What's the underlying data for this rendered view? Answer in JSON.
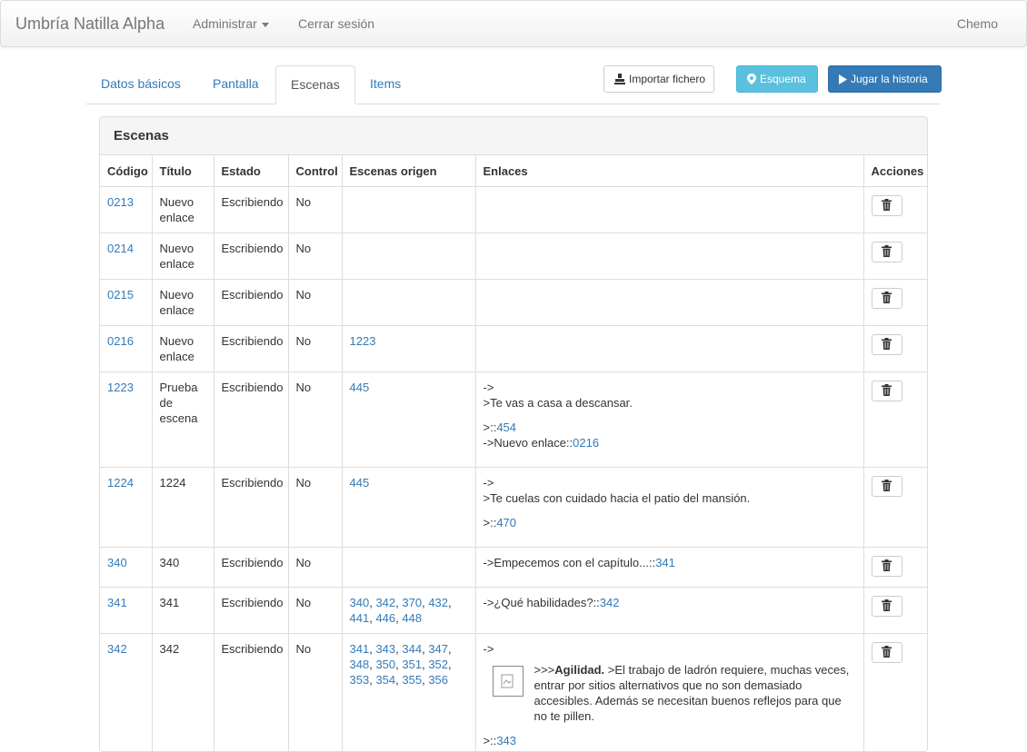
{
  "navbar": {
    "brand": "Umbría Natilla Alpha",
    "admin": "Administrar",
    "logout": "Cerrar sesión",
    "user": "Chemo"
  },
  "tabs": [
    "Datos básicos",
    "Pantalla",
    "Escenas",
    "Items"
  ],
  "buttons": {
    "import": "Importar fichero",
    "schema": "Esquema",
    "play": "Jugar la historia"
  },
  "panel": {
    "title": "Escenas"
  },
  "table": {
    "headers": [
      "Código",
      "Título",
      "Estado",
      "Control",
      "Escenas origen",
      "Enlaces",
      "Acciones"
    ],
    "rows": [
      {
        "code": "0213",
        "title": "Nuevo enlace",
        "state": "Escribiendo",
        "control": "No",
        "origins": [],
        "links": []
      },
      {
        "code": "0214",
        "title": "Nuevo enlace",
        "state": "Escribiendo",
        "control": "No",
        "origins": [],
        "links": []
      },
      {
        "code": "0215",
        "title": "Nuevo enlace",
        "state": "Escribiendo",
        "control": "No",
        "origins": [],
        "links": []
      },
      {
        "code": "0216",
        "title": "Nuevo enlace",
        "state": "Escribiendo",
        "control": "No",
        "origins": [
          "1223"
        ],
        "links": []
      },
      {
        "code": "1223",
        "title": "Prueba de escena",
        "state": "Escribiendo",
        "control": "No",
        "origins": [
          "445"
        ],
        "links": [
          {
            "lines": [
              "->",
              ">Te vas a casa a descansar."
            ]
          },
          {
            "gap": true,
            "text": ">::",
            "link": "454"
          },
          {
            "text": "->Nuevo enlace::",
            "link": "0216"
          }
        ]
      },
      {
        "code": "1224",
        "title": "1224",
        "state": "Escribiendo",
        "control": "No",
        "origins": [
          "445"
        ],
        "links": [
          {
            "lines": [
              "->",
              ">Te cuelas con cuidado hacia el patio del mansión."
            ]
          },
          {
            "gap": true,
            "text": ">::",
            "link": "470"
          }
        ]
      },
      {
        "code": "340",
        "title": "340",
        "state": "Escribiendo",
        "control": "No",
        "origins": [],
        "links": [
          {
            "text": "->Empecemos con el capítulo...::",
            "link": "341"
          }
        ]
      },
      {
        "code": "341",
        "title": "341",
        "state": "Escribiendo",
        "control": "No",
        "origins": [
          "340",
          "342",
          "370",
          "432",
          "441",
          "446",
          "448"
        ],
        "links": [
          {
            "text": "->¿Qué habilidades?::",
            "link": "342"
          }
        ]
      },
      {
        "code": "342",
        "title": "342",
        "state": "Escribiendo",
        "control": "No",
        "origins": [
          "341",
          "343",
          "344",
          "347",
          "348",
          "350",
          "351",
          "352",
          "353",
          "354",
          "355",
          "356"
        ],
        "links": [
          {
            "lines": [
              "->"
            ]
          },
          {
            "rich": true,
            "prefix": ">>>",
            "bold": "Agilidad.",
            "text": " >El trabajo de ladrón requiere, muchas veces, entrar por sitios alternativos que no son demasiado accesibles. Además se necesitan buenos reflejos para que no te pillen."
          },
          {
            "text": ">::",
            "link": "343"
          },
          {
            "lines": [
              "->"
            ]
          }
        ]
      }
    ]
  },
  "colors": {
    "link": "#337ab7",
    "info": "#5bc0de",
    "primary": "#337ab7"
  },
  "icons": {
    "import": "stamp-icon",
    "schema": "map-marker-icon",
    "play": "play-icon",
    "delete": "trash-icon",
    "image": "broken-image-icon"
  }
}
